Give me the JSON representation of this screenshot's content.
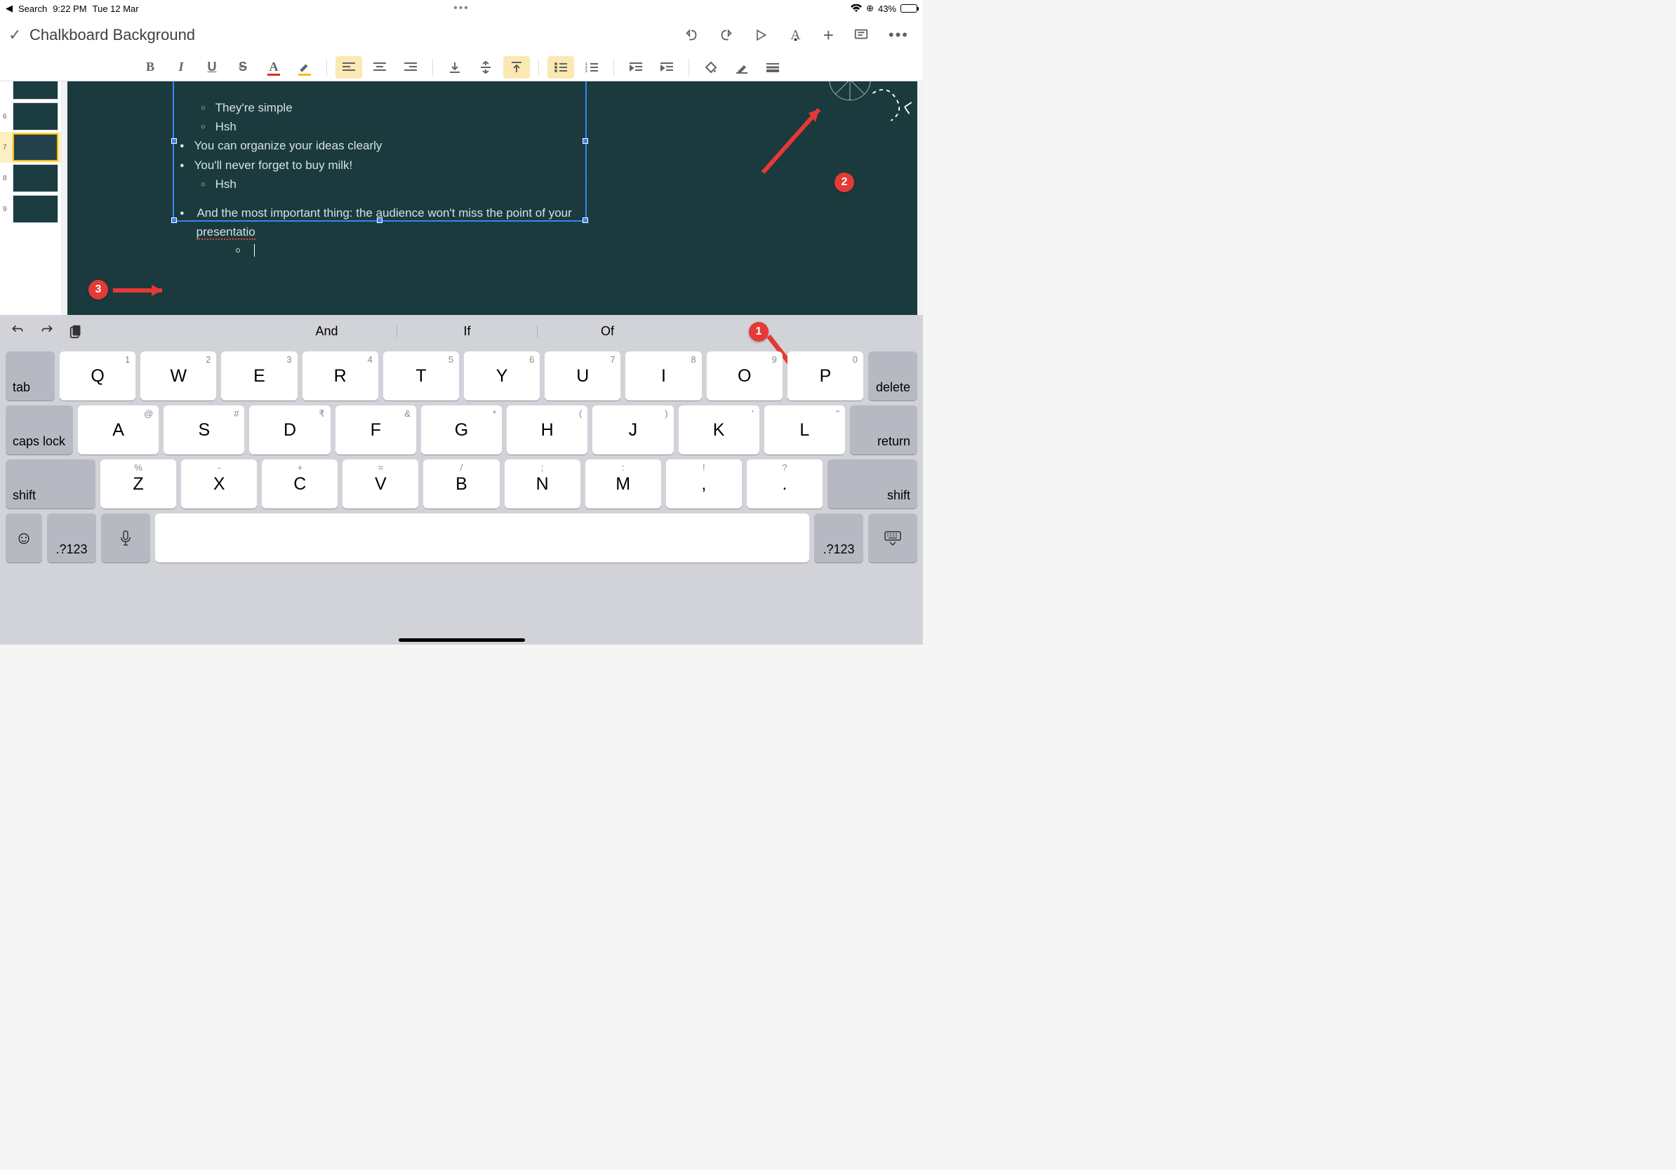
{
  "status": {
    "back_app": "Search",
    "time": "9:22 PM",
    "date": "Tue 12 Mar",
    "battery_pct": "43%"
  },
  "doc": {
    "title": "Chalkboard Background"
  },
  "title_actions": {
    "undo": "↶",
    "redo": "↷",
    "present": "▷",
    "text_format": "A",
    "insert": "+",
    "comment": "▤",
    "more": "⋯"
  },
  "format_bar": {
    "bold": "B",
    "italic": "I",
    "underline": "U",
    "strike": "S",
    "text_color": "A",
    "highlight": "✎",
    "align_left": "≡",
    "align_center": "≡",
    "align_right": "≡",
    "valign_top": "↧",
    "valign_mid": "⇵",
    "valign_bot": "↥",
    "list_bullet": "•≡",
    "list_num": "1≡",
    "indent_less": "⇤",
    "indent_more": "⇥",
    "fill": "◆",
    "border": "✎",
    "lines": "≡"
  },
  "thumbs": {
    "nums": [
      "6",
      "7",
      "8",
      "9"
    ],
    "selected": 1
  },
  "slide": {
    "box_lines": {
      "sub1": "They're simple",
      "sub2": "Hsh",
      "line3": "You can organize your ideas clearly",
      "line4": "You'll never forget to buy milk!",
      "sub5": "Hsh"
    },
    "para2_a": "And the most important thing: the audience won't miss the point of your ",
    "para2_b": "presentatio"
  },
  "annotations": {
    "a1": "1",
    "a2": "2",
    "a3": "3"
  },
  "keyboard": {
    "suggestions": [
      "And",
      "If",
      "Of"
    ],
    "row1": {
      "keys": [
        "Q",
        "W",
        "E",
        "R",
        "T",
        "Y",
        "U",
        "I",
        "O",
        "P"
      ],
      "hints": [
        "1",
        "2",
        "3",
        "4",
        "5",
        "6",
        "7",
        "8",
        "9",
        "0"
      ]
    },
    "row2": {
      "keys": [
        "A",
        "S",
        "D",
        "F",
        "G",
        "H",
        "J",
        "K",
        "L"
      ],
      "hints": [
        "@",
        "#",
        "₹",
        "&",
        "*",
        "(",
        ")",
        "'",
        "\""
      ]
    },
    "row3": {
      "keys": [
        "Z",
        "X",
        "C",
        "V",
        "B",
        "N",
        "M",
        ",",
        "."
      ],
      "alts": [
        "%",
        "-",
        "+",
        "=",
        "/",
        ";",
        ":",
        "!",
        "?"
      ]
    },
    "labels": {
      "tab": "tab",
      "delete": "delete",
      "caps": "caps lock",
      "return": "return",
      "shift": "shift",
      "numsym": ".?123"
    }
  }
}
